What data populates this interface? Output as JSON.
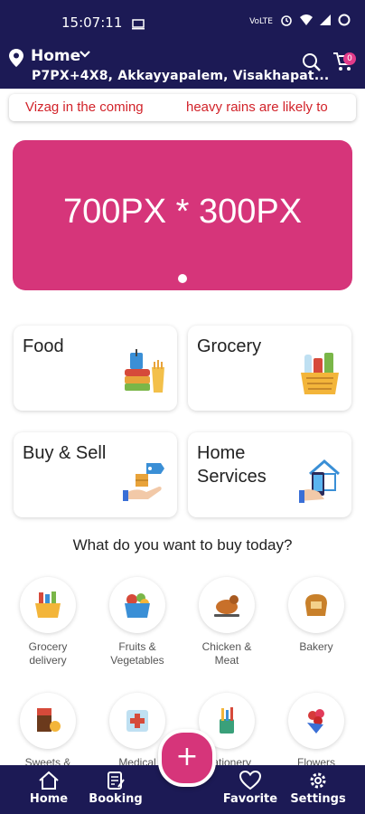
{
  "status_bar": {
    "time": "15:07:11",
    "battery_icon": "battery-icon"
  },
  "header": {
    "location_title": "Home",
    "address": "P7PX+4X8, Akkayyapalem, Visakhapat...",
    "cart_count": "0"
  },
  "ticker": {
    "left_text": "Vizag in the coming",
    "right_text": "heavy rains are likely to"
  },
  "banner": {
    "text": "700PX * 300PX"
  },
  "services": [
    {
      "label": "Food",
      "icon": "food-icon"
    },
    {
      "label": "Grocery",
      "icon": "grocery-basket-icon"
    },
    {
      "label": "Buy & Sell",
      "icon": "buy-sell-icon"
    },
    {
      "label_line1": "Home",
      "label_line2": "Services",
      "icon": "home-services-icon"
    }
  ],
  "section_title": "What do you want to buy today?",
  "categories": [
    {
      "label_line1": "Grocery",
      "label_line2": "delivery"
    },
    {
      "label_line1": "Fruits &",
      "label_line2": "Vegetables"
    },
    {
      "label_line1": "Chicken &",
      "label_line2": "Meat"
    },
    {
      "label_line1": "Bakery",
      "label_line2": ""
    },
    {
      "label_line1": "Sweets &",
      "label_line2": ""
    },
    {
      "label_line1": "Medical",
      "label_line2": ""
    },
    {
      "label_line1": "Stationery",
      "label_line2": ""
    },
    {
      "label_line1": "Flowers",
      "label_line2": ""
    }
  ],
  "bottom_nav": {
    "home": "Home",
    "booking": "Booking",
    "favorite": "Favorite",
    "settings": "Settings"
  },
  "fab": {
    "label": "+"
  },
  "colors": {
    "navy": "#1c1a55",
    "pink": "#d6357a",
    "red_ticker": "#d2232a"
  }
}
